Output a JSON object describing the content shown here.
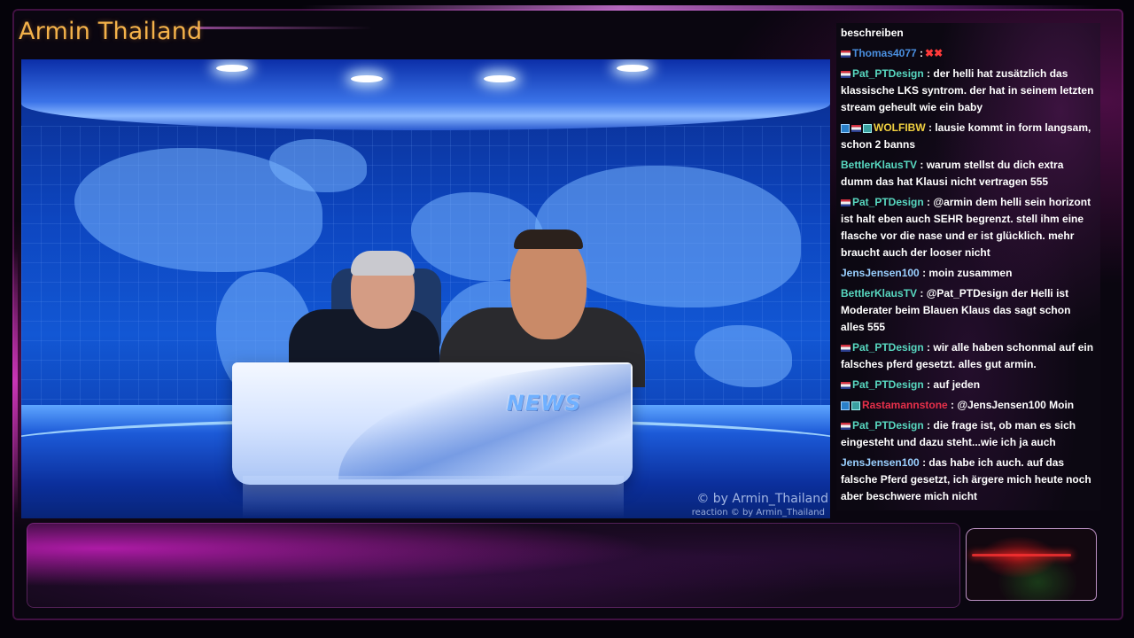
{
  "channel": {
    "title": "Armin Thailand"
  },
  "video": {
    "desk_label": "NEWS",
    "watermark": "© by Armin_Thailand",
    "watermark_small": "reaction  © by Armin_Thailand"
  },
  "chat": {
    "messages": [
      {
        "user": "",
        "user_color": "#ffffff",
        "text": "beschreiben",
        "badges": []
      },
      {
        "user": "Thomas4077",
        "user_color": "#4a8fe0",
        "text": ":",
        "badges": [
          "flag"
        ],
        "emote": "✖✖"
      },
      {
        "user": "Pat_PTDesign",
        "user_color": "#58d8c0",
        "text": ": der helli hat zusätzlich das klassische LKS syntrom. der hat in seinem letzten stream geheult wie ein baby",
        "badges": [
          "flag"
        ]
      },
      {
        "user": "WOLFIBW",
        "user_color": "#f0d040",
        "text": ": lausie kommt in form langsam, schon 2 banns",
        "badges": [
          "tv",
          "flag",
          "sub"
        ]
      },
      {
        "user": "BettlerKlausTV",
        "user_color": "#58d8c0",
        "text": ": warum stellst du dich extra dumm das hat Klausi nicht vertragen 555",
        "badges": []
      },
      {
        "user": "Pat_PTDesign",
        "user_color": "#58d8c0",
        "text": ": @armin dem helli sein horizont ist halt eben auch SEHR begrenzt. stell ihm eine flasche vor die nase und er ist glücklich. mehr braucht auch der looser nicht",
        "badges": [
          "flag"
        ]
      },
      {
        "user": "JensJensen100",
        "user_color": "#9ad0ff",
        "text": ": moin zusammen",
        "badges": []
      },
      {
        "user": "BettlerKlausTV",
        "user_color": "#58d8c0",
        "text": ": @Pat_PTDesign der Helli ist Moderater beim Blauen Klaus das sagt schon alles 555",
        "badges": []
      },
      {
        "user": "Pat_PTDesign",
        "user_color": "#58d8c0",
        "text": ": wir alle haben schonmal auf ein falsches pferd gesetzt. alles gut armin.",
        "badges": [
          "flag"
        ]
      },
      {
        "user": "Pat_PTDesign",
        "user_color": "#58d8c0",
        "text": ": auf jeden",
        "badges": [
          "flag"
        ]
      },
      {
        "user": "Rastamannstone",
        "user_color": "#e8304a",
        "text": ": @JensJensen100 Moin",
        "badges": [
          "tv",
          "sub"
        ]
      },
      {
        "user": "Pat_PTDesign",
        "user_color": "#58d8c0",
        "text": ": die frage ist, ob man es sich eingesteht und dazu steht...wie ich ja auch",
        "badges": [
          "flag"
        ]
      },
      {
        "user": "JensJensen100",
        "user_color": "#9ad0ff",
        "text": ": das habe ich auch. auf das falsche Pferd gesetzt, ich ärgere mich heute noch aber beschwere mich nicht",
        "badges": []
      }
    ]
  },
  "colors": {
    "title": "#f4b24a",
    "accent": "#c040c0"
  }
}
